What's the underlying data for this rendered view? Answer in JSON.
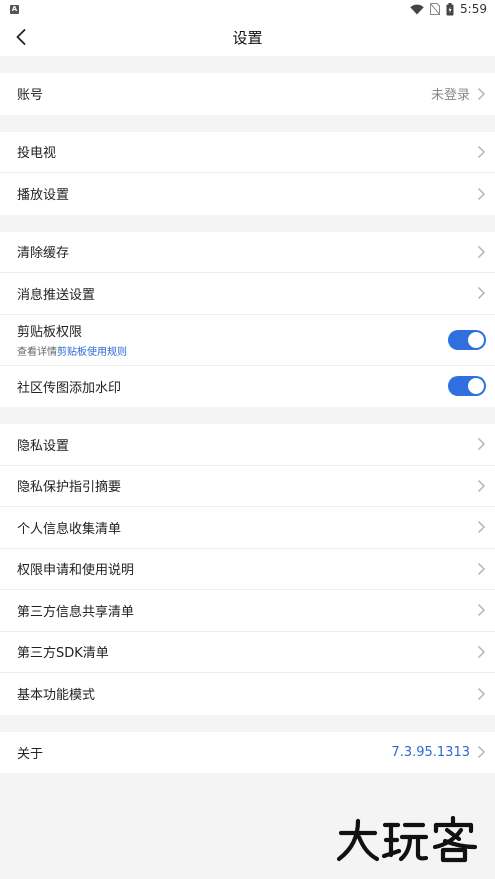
{
  "status_bar": {
    "time": "5:59",
    "app_badge": "A"
  },
  "header": {
    "title": "设置"
  },
  "groups": {
    "account": {
      "label": "账号",
      "value": "未登录"
    },
    "cast": {
      "label": "投电视"
    },
    "playback": {
      "label": "播放设置"
    },
    "clear_cache": {
      "label": "清除缓存"
    },
    "push": {
      "label": "消息推送设置"
    },
    "clipboard": {
      "label": "剪贴板权限",
      "sub_prefix": "查看详情",
      "sub_link": "剪贴板使用规则",
      "enabled": true
    },
    "watermark": {
      "label": "社区传图添加水印",
      "enabled": true
    },
    "privacy_settings": {
      "label": "隐私设置"
    },
    "privacy_summary": {
      "label": "隐私保护指引摘要"
    },
    "personal_info": {
      "label": "个人信息收集清单"
    },
    "permissions": {
      "label": "权限申请和使用说明"
    },
    "third_party_share": {
      "label": "第三方信息共享清单"
    },
    "third_party_sdk": {
      "label": "第三方SDK清单"
    },
    "basic_mode": {
      "label": "基本功能模式"
    },
    "about": {
      "label": "关于",
      "value": "7.3.95.1313"
    }
  },
  "watermark_logo": {
    "text": "大玩客"
  },
  "colors": {
    "accent": "#2f6fe0",
    "link": "#2a6bd6",
    "background": "#f4f4f4"
  }
}
